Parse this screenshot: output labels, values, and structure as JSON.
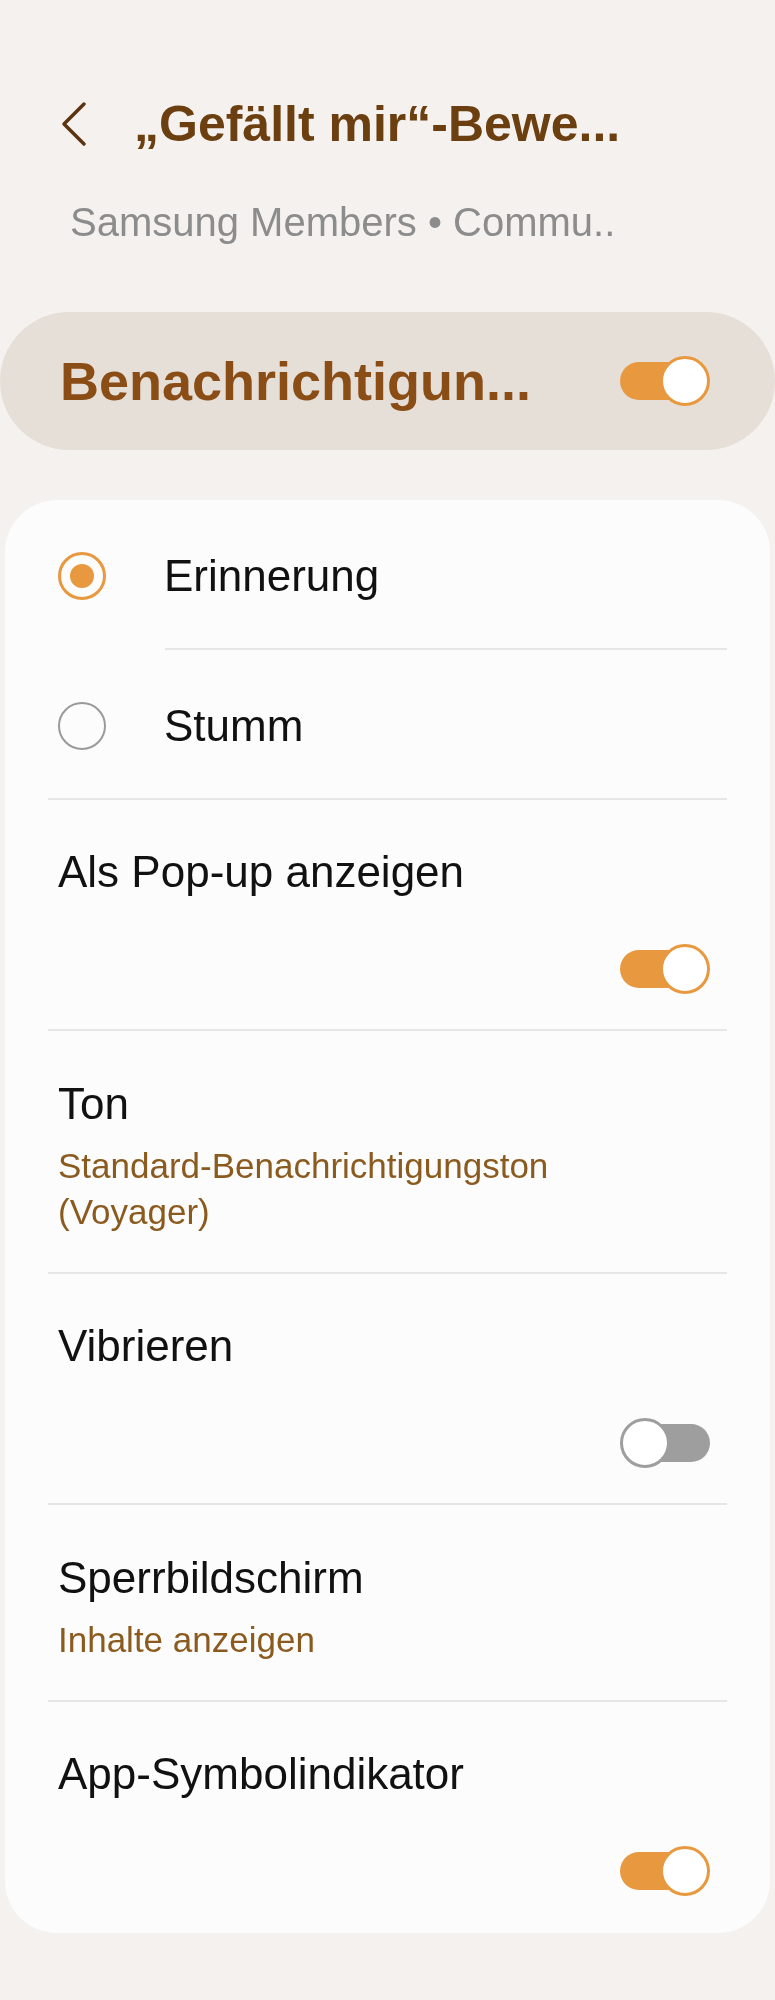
{
  "header": {
    "title": "„Gefällt mir“-Bewe...",
    "subtitle": "Samsung Members • Commu.."
  },
  "master": {
    "label": "Benachrichtigun...",
    "on": true
  },
  "items": [
    {
      "kind": "radio",
      "label": "Erinnerung",
      "selected": true
    },
    {
      "kind": "radio",
      "label": "Stumm",
      "selected": false
    },
    {
      "kind": "switch",
      "label": "Als Pop-up anzeigen",
      "on": true
    },
    {
      "kind": "value",
      "label": "Ton",
      "summary": "Standard-Benachrichtigungston (Voyager)"
    },
    {
      "kind": "switch",
      "label": "Vibrieren",
      "on": false
    },
    {
      "kind": "value",
      "label": "Sperrbildschirm",
      "summary": "Inhalte anzeigen"
    },
    {
      "kind": "switch",
      "label": "App-Symbolindikator",
      "on": true
    }
  ]
}
